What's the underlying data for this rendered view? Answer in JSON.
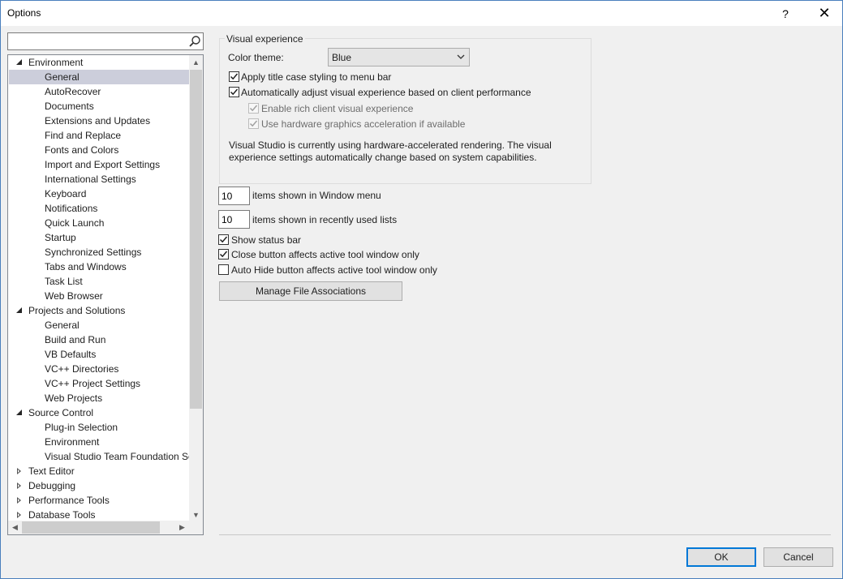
{
  "window": {
    "title": "Options",
    "help_symbol": "?",
    "close_symbol": "✕"
  },
  "search": {
    "value": "",
    "placeholder": ""
  },
  "tree": {
    "items": [
      {
        "label": "Environment",
        "level": 0,
        "state": "expanded"
      },
      {
        "label": "General",
        "level": 1,
        "selected": true
      },
      {
        "label": "AutoRecover",
        "level": 1
      },
      {
        "label": "Documents",
        "level": 1
      },
      {
        "label": "Extensions and Updates",
        "level": 1
      },
      {
        "label": "Find and Replace",
        "level": 1
      },
      {
        "label": "Fonts and Colors",
        "level": 1
      },
      {
        "label": "Import and Export Settings",
        "level": 1
      },
      {
        "label": "International Settings",
        "level": 1
      },
      {
        "label": "Keyboard",
        "level": 1
      },
      {
        "label": "Notifications",
        "level": 1
      },
      {
        "label": "Quick Launch",
        "level": 1
      },
      {
        "label": "Startup",
        "level": 1
      },
      {
        "label": "Synchronized Settings",
        "level": 1
      },
      {
        "label": "Tabs and Windows",
        "level": 1
      },
      {
        "label": "Task List",
        "level": 1
      },
      {
        "label": "Web Browser",
        "level": 1
      },
      {
        "label": "Projects and Solutions",
        "level": 0,
        "state": "expanded"
      },
      {
        "label": "General",
        "level": 1
      },
      {
        "label": "Build and Run",
        "level": 1
      },
      {
        "label": "VB Defaults",
        "level": 1
      },
      {
        "label": "VC++ Directories",
        "level": 1
      },
      {
        "label": "VC++ Project Settings",
        "level": 1
      },
      {
        "label": "Web Projects",
        "level": 1
      },
      {
        "label": "Source Control",
        "level": 0,
        "state": "expanded"
      },
      {
        "label": "Plug-in Selection",
        "level": 1
      },
      {
        "label": "Environment",
        "level": 1
      },
      {
        "label": "Visual Studio Team Foundation Server",
        "level": 1
      },
      {
        "label": "Text Editor",
        "level": 0,
        "state": "collapsed"
      },
      {
        "label": "Debugging",
        "level": 0,
        "state": "collapsed"
      },
      {
        "label": "Performance Tools",
        "level": 0,
        "state": "collapsed"
      },
      {
        "label": "Database Tools",
        "level": 0,
        "state": "collapsed"
      }
    ]
  },
  "visual_experience": {
    "group_label": "Visual experience",
    "color_theme_label": "Color theme:",
    "color_theme_value": "Blue",
    "apply_title_case": {
      "label": "Apply title case styling to menu bar",
      "checked": true
    },
    "auto_adjust": {
      "label": "Automatically adjust visual experience based on client performance",
      "checked": true
    },
    "rich_client": {
      "label": "Enable rich client visual experience",
      "checked": true,
      "enabled": false
    },
    "hw_accel": {
      "label": "Use hardware graphics acceleration if available",
      "checked": true,
      "enabled": false
    },
    "info_line1": "Visual Studio is currently using hardware-accelerated rendering. The visual",
    "info_line2": "experience settings automatically change based on system capabilities."
  },
  "window_menu": {
    "value": "10",
    "label": "items shown in Window menu"
  },
  "recent_lists": {
    "value": "10",
    "label": "items shown in recently used lists"
  },
  "show_status_bar": {
    "label": "Show status bar",
    "checked": true
  },
  "close_button_active": {
    "label": "Close button affects active tool window only",
    "checked": true
  },
  "autohide_active": {
    "label": "Auto Hide button affects active tool window only",
    "checked": false
  },
  "manage_file_assoc": {
    "label": "Manage File Associations"
  },
  "footer": {
    "ok_label": "OK",
    "cancel_label": "Cancel"
  },
  "colors": {
    "selection": "#cccedb",
    "accent": "#0078d7",
    "window_border": "#4a7fbd"
  }
}
